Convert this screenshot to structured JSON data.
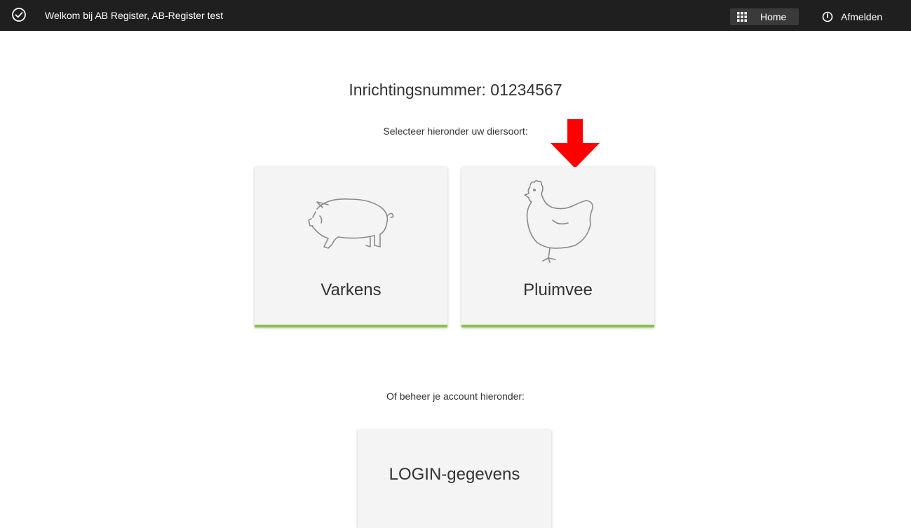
{
  "header": {
    "welcome_text": "Welkom bij AB Register, AB-Register test",
    "home_label": "Home",
    "logout_label": "Afmelden",
    "background_color": "#1f1f1f"
  },
  "main": {
    "title": "Inrichtingsnummer: 01234567",
    "select_prompt": "Selecteer hieronder uw diersoort:",
    "animal_cards": [
      {
        "label": "Varkens",
        "icon": "pig-icon"
      },
      {
        "label": "Pluimvee",
        "icon": "chicken-icon"
      }
    ],
    "account_prompt": "Of beheer je account hieronder:",
    "login_card": {
      "label": "LOGIN-gegevens"
    },
    "accent_color": "#8ac04a",
    "annotation_arrow_color": "#ff0000"
  }
}
